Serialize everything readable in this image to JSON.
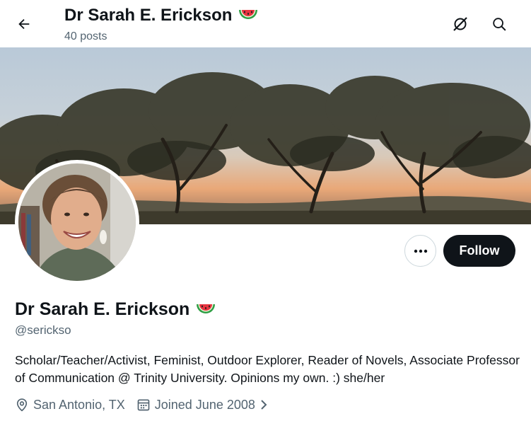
{
  "header": {
    "title": "Dr Sarah E. Erickson",
    "posts_count": "40 posts",
    "back_icon": "arrow-left-icon",
    "grok_icon": "grok-icon",
    "search_icon": "search-icon"
  },
  "profile": {
    "display_name": "Dr Sarah E. Erickson",
    "name_emoji": "watermelon-icon",
    "handle": "@serickso",
    "bio": "Scholar/Teacher/Activist, Feminist, Outdoor Explorer, Reader of Novels, Associate Professor of Communication @ Trinity University. Opinions my own. :) she/her",
    "location": "San Antonio, TX",
    "joined": "Joined June 2008",
    "location_icon": "location-pin-icon",
    "calendar_icon": "calendar-icon",
    "chevron_icon": "chevron-right-icon"
  },
  "actions": {
    "more_icon": "more-horizontal-icon",
    "follow_label": "Follow"
  },
  "colors": {
    "primary_text": "#0f1419",
    "secondary_text": "#536471",
    "follow_bg": "#0f1419",
    "border": "#cfd9de"
  }
}
